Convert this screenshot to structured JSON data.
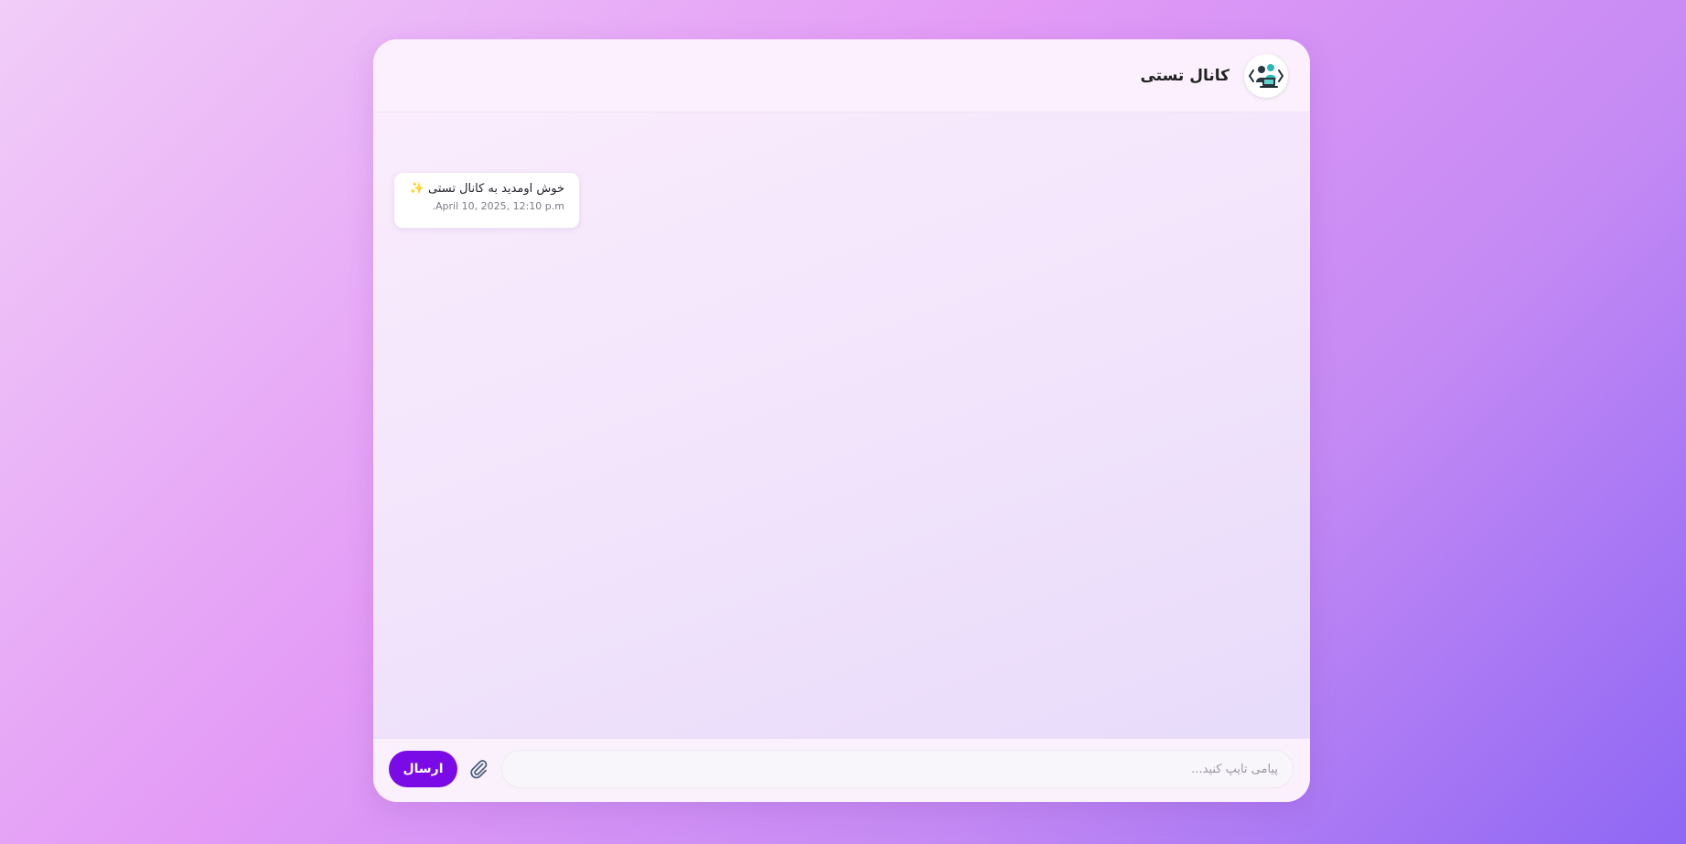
{
  "header": {
    "title": "کانال تستی",
    "avatar_icon": "coding-team-icon"
  },
  "messages": [
    {
      "text": "خوش اومدید به کانال تستی ✨",
      "time": "April 10, 2025, 12:10 p.m."
    }
  ],
  "composer": {
    "placeholder": "پیامی تایپ کنید...",
    "value": "",
    "attach_icon": "paperclip-icon",
    "send_label": "ارسال"
  },
  "colors": {
    "accent": "#7a0be6",
    "background_start": "#f1cdf8",
    "background_end": "#8e67f4"
  }
}
